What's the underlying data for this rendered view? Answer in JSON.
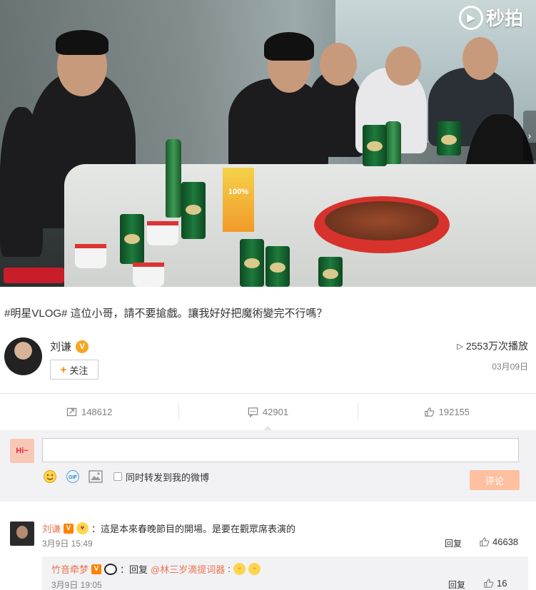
{
  "video": {
    "watermark": "秒拍",
    "juice_label": "100%",
    "next_icon": "chevron-right-icon"
  },
  "post": {
    "caption": "#明星VLOG# 這位小哥，請不要搶戲。讓我好好把魔術變完不行嗎？",
    "author": "刘谦",
    "follow_label": "关注",
    "play_count": "2553万次播放",
    "date": "03月09日"
  },
  "actions": {
    "repost_count": "148612",
    "comment_count": "42901",
    "like_count": "192155"
  },
  "composer": {
    "avatar_text": "Hi~",
    "input_value": "",
    "sync_label": "同时转发到我的微博",
    "submit_label": "评论",
    "submit_color": "#ffc09f"
  },
  "comments": [
    {
      "name": "刘谦",
      "text": "：這是本來春晚節目的開場。是要在觀眾席表演的",
      "time": "3月9日 15:49",
      "reply_label": "回复",
      "likes": "46638"
    }
  ],
  "replies": [
    {
      "name": "竹音牵梦",
      "prefix": "：回复",
      "mention": "@林三岁滴提词器",
      "suffix": ":",
      "time": "3月9日 19:05",
      "reply_label": "回复",
      "likes": "16"
    }
  ],
  "colors": {
    "accent": "#ff8200",
    "name_link": "#eb7350",
    "muted": "#808080"
  }
}
